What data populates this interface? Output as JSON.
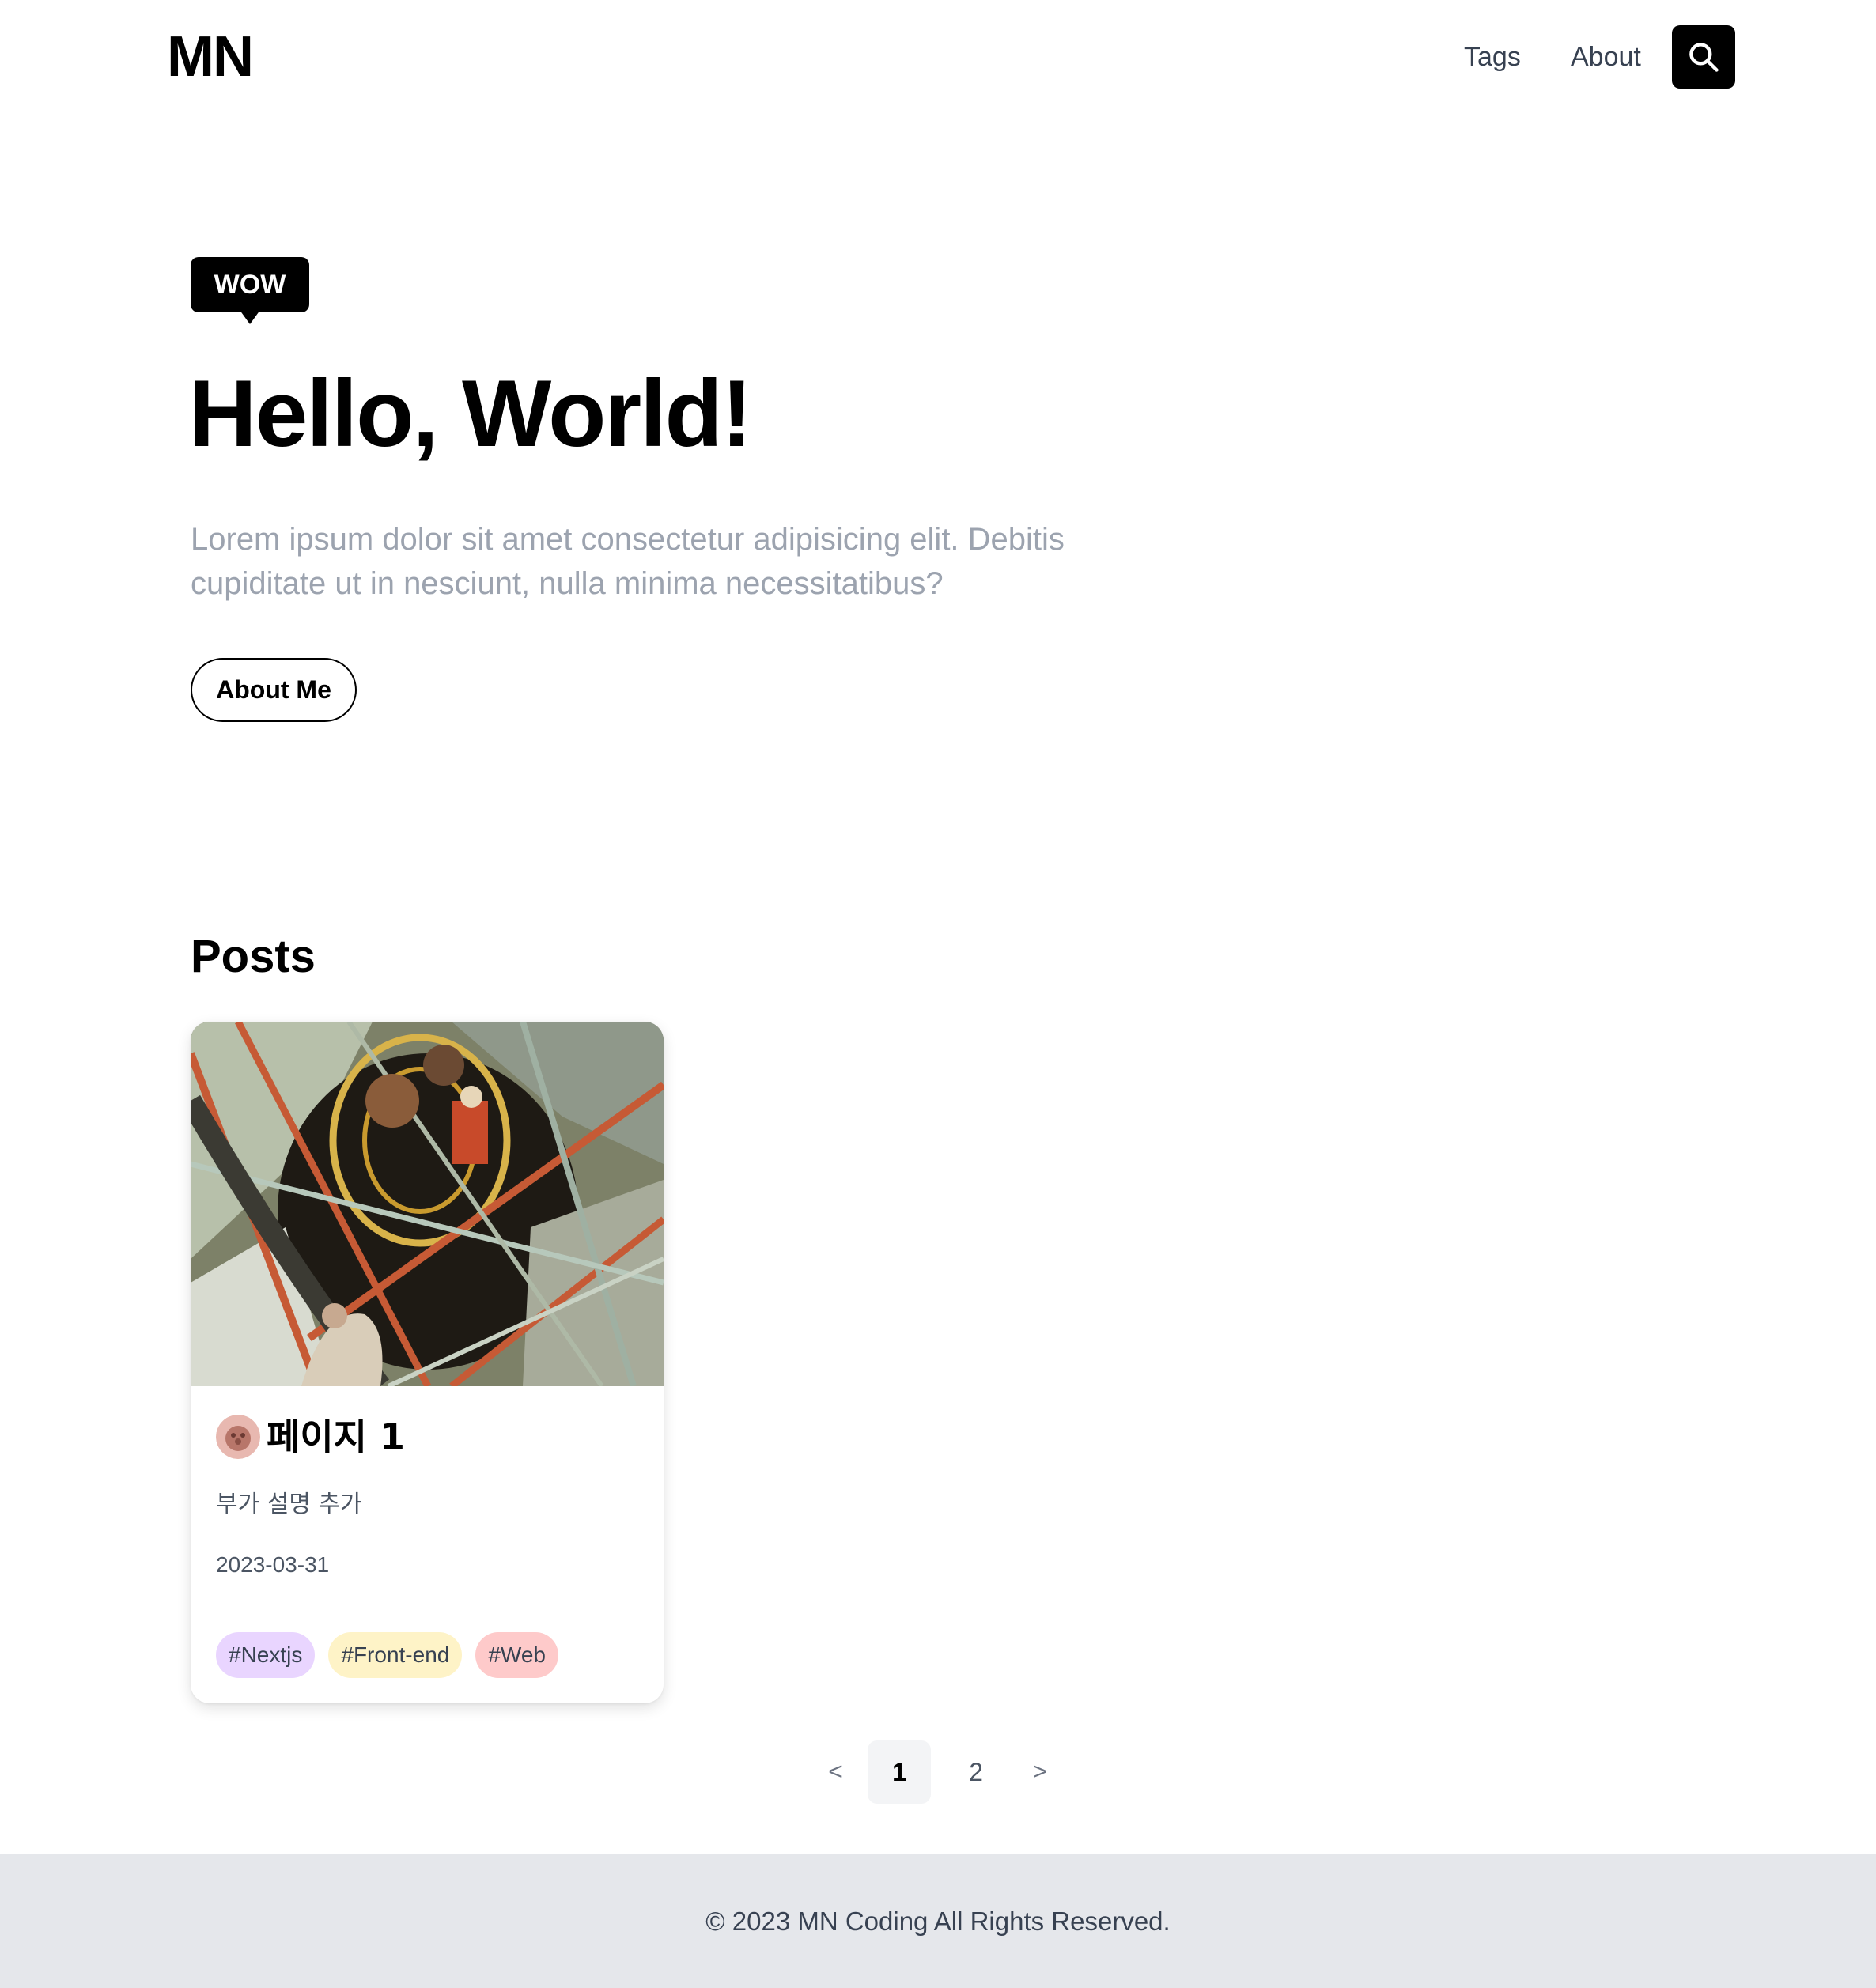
{
  "header": {
    "logo": "MN",
    "nav": [
      {
        "label": "Tags"
      },
      {
        "label": "About"
      }
    ],
    "search_icon": "search-icon"
  },
  "hero": {
    "badge": "WOW",
    "title": "Hello, World!",
    "description": "Lorem ipsum dolor sit amet consectetur adipisicing elit. Debitis cupiditate ut in nesciunt, nulla minima necessitatibus?",
    "button_label": "About Me"
  },
  "posts": {
    "heading": "Posts",
    "items": [
      {
        "title": "페이지 1",
        "subtitle": "부가 설명 추가",
        "date": "2023-03-31",
        "tags": [
          {
            "label": "#Nextjs",
            "color": "#e9d5ff"
          },
          {
            "label": "#Front-end",
            "color": "#fef3c7"
          },
          {
            "label": "#Web",
            "color": "#fecaca"
          }
        ]
      }
    ]
  },
  "pagination": {
    "prev": "<",
    "pages": [
      "1",
      "2"
    ],
    "current": "1",
    "next": ">"
  },
  "footer": {
    "text": "© 2023 MN Coding All Rights Reserved."
  }
}
